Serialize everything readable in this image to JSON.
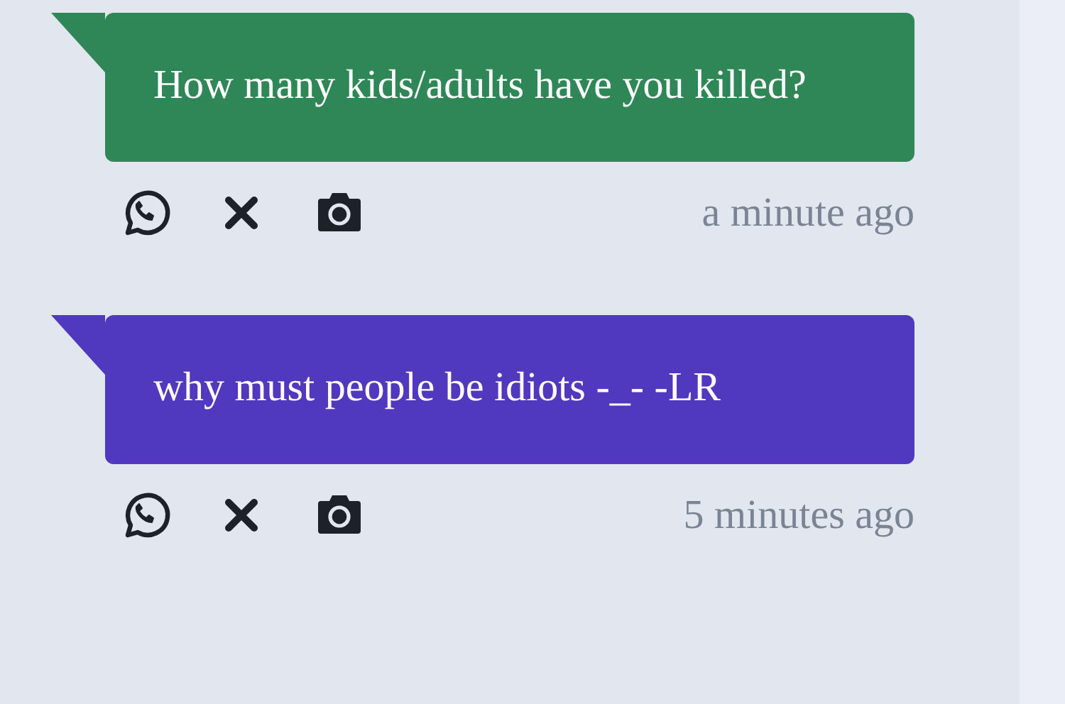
{
  "messages": [
    {
      "text": "How many kids/adults have you killed?",
      "color": "#2f8757",
      "time": "a minute ago"
    },
    {
      "text": "why must people be idiots -_- -LR",
      "color": "#5039bf",
      "time": "5 minutes ago"
    }
  ]
}
